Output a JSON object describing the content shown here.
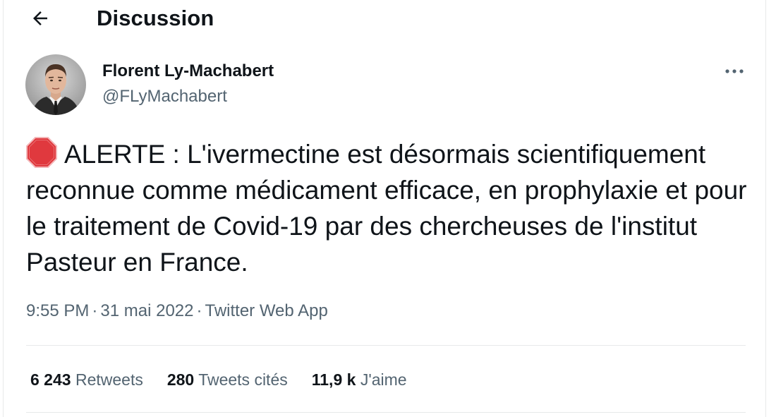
{
  "header": {
    "title": "Discussion",
    "back_icon": "arrow-left-icon"
  },
  "author": {
    "name": "Florent Ly-Machabert",
    "handle": "@FLyMachabert",
    "avatar_icon": "profile-photo"
  },
  "tweet": {
    "emoji_icon": "stop-sign-icon",
    "text": "ALERTE : L'ivermectine est désormais scientifiquement reconnue comme médicament efficace, en prophylaxie et pour le traitement de Covid-19 par des chercheuses de l'institut Pasteur en France."
  },
  "meta": {
    "time": "9:55 PM",
    "date": "31 mai 2022",
    "source": "Twitter Web App",
    "separator": "·"
  },
  "stats": {
    "retweets": {
      "value": "6 243",
      "label": "Retweets"
    },
    "quotes": {
      "value": "280",
      "label": "Tweets cités"
    },
    "likes": {
      "value": "11,9 k",
      "label": "J'aime"
    }
  },
  "colors": {
    "text": "#0f1419",
    "secondary": "#536471",
    "divider": "#e7e9ea",
    "stop_sign": "#e0393e"
  }
}
